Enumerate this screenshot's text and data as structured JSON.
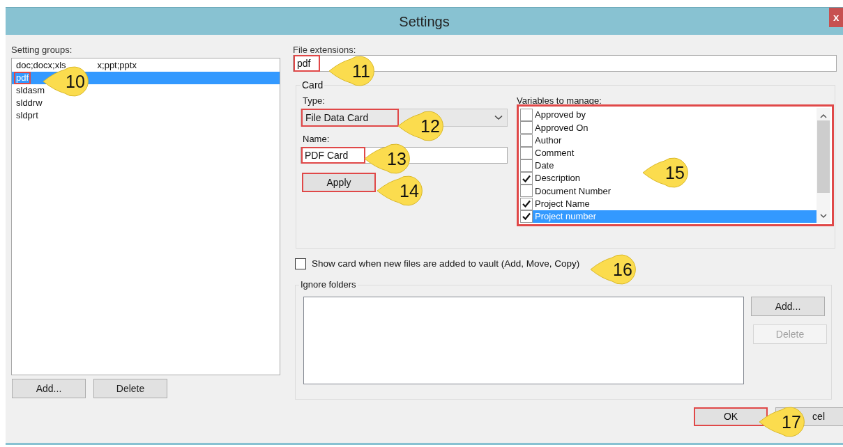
{
  "window": {
    "title": "Settings",
    "close": "x"
  },
  "setting_groups": {
    "label": "Setting groups:",
    "items": [
      {
        "text": "doc;docx;xls",
        "text_after": "x;ppt;pptx",
        "selected": false,
        "highlighted": false
      },
      {
        "text": "pdf",
        "selected": true,
        "highlighted": true
      },
      {
        "text": "sldasm",
        "selected": false,
        "highlighted": false
      },
      {
        "text": "slddrw",
        "selected": false,
        "highlighted": false
      },
      {
        "text": "sldprt",
        "selected": false,
        "highlighted": false
      }
    ],
    "buttons": [
      {
        "label": "Add...",
        "disabled": false
      },
      {
        "label": "Delete",
        "disabled": false
      }
    ]
  },
  "file_extensions": {
    "label": "File extensions:",
    "value": "pdf",
    "highlighted": true
  },
  "card": {
    "legend": "Card",
    "type_label": "Type:",
    "type_value": "File Data Card",
    "type_highlighted": true,
    "name_label": "Name:",
    "name_value": "PDF Card",
    "name_highlighted": true,
    "apply": {
      "label": "Apply",
      "highlighted": true
    },
    "variables_label": "Variables to manage:",
    "variables_highlighted": true,
    "variables": [
      {
        "text": "Approved by",
        "checked": false,
        "selected": false
      },
      {
        "text": "Approved On",
        "checked": false,
        "selected": false
      },
      {
        "text": "Author",
        "checked": false,
        "selected": false
      },
      {
        "text": "Comment",
        "checked": false,
        "selected": false
      },
      {
        "text": "Date",
        "checked": false,
        "selected": false
      },
      {
        "text": "Description",
        "checked": true,
        "selected": false
      },
      {
        "text": "Document Number",
        "checked": false,
        "selected": false
      },
      {
        "text": "Project Name",
        "checked": true,
        "selected": false
      },
      {
        "text": "Project number",
        "checked": true,
        "selected": true
      }
    ]
  },
  "show_card": {
    "label": "Show card when new files are added to vault (Add, Move, Copy)",
    "checked": false
  },
  "ignore_folders": {
    "legend": "Ignore folders",
    "buttons": [
      {
        "label": "Add...",
        "disabled": false
      },
      {
        "label": "Delete",
        "disabled": true
      }
    ]
  },
  "footer_buttons": [
    {
      "label": "OK",
      "highlighted": true
    },
    {
      "label": "cel",
      "highlighted": false
    }
  ],
  "callouts": [
    {
      "label": "10"
    },
    {
      "label": "11"
    },
    {
      "label": "12"
    },
    {
      "label": "13"
    },
    {
      "label": "14"
    },
    {
      "label": "15"
    },
    {
      "label": "16"
    },
    {
      "label": "17"
    }
  ]
}
